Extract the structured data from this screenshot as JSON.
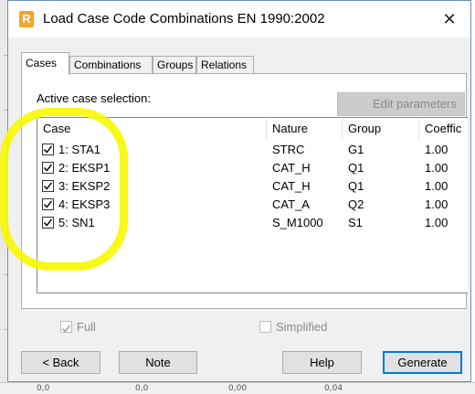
{
  "window": {
    "title": "Load Case Code Combinations EN 1990:2002",
    "icon": "robot-app-icon",
    "close_glyph": "✕"
  },
  "tabs": [
    {
      "label": "Cases",
      "active": true
    },
    {
      "label": "Combinations",
      "active": false
    },
    {
      "label": "Groups",
      "active": false
    },
    {
      "label": "Relations",
      "active": false
    }
  ],
  "panel": {
    "section_label": "Active case selection:",
    "edit_button": "Edit parameters",
    "columns": [
      "Case",
      "Nature",
      "Group",
      "Coeffic"
    ],
    "rows": [
      {
        "checked": true,
        "case": "1: STA1",
        "nature": "STRC",
        "group": "G1",
        "coef": "1.00"
      },
      {
        "checked": true,
        "case": "2: EKSP1",
        "nature": "CAT_H",
        "group": "Q1",
        "coef": "1.00"
      },
      {
        "checked": true,
        "case": "3: EKSP2",
        "nature": "CAT_H",
        "group": "Q1",
        "coef": "1.00"
      },
      {
        "checked": true,
        "case": "4: EKSP3",
        "nature": "CAT_A",
        "group": "Q2",
        "coef": "1.00"
      },
      {
        "checked": true,
        "case": "5: SN1",
        "nature": "S_M1000",
        "group": "S1",
        "coef": "1.00"
      }
    ]
  },
  "options": {
    "full": {
      "label": "Full",
      "checked": true,
      "enabled": false
    },
    "simplified": {
      "label": "Simplified",
      "checked": false,
      "enabled": false
    }
  },
  "buttons": {
    "back": "< Back",
    "note": "Note",
    "help": "Help",
    "generate": "Generate"
  },
  "background_ticks": [
    "0,0",
    "0,0",
    "0,00",
    "0,04"
  ],
  "colors": {
    "highlight": "#f7f700",
    "accent": "#0078d7"
  }
}
